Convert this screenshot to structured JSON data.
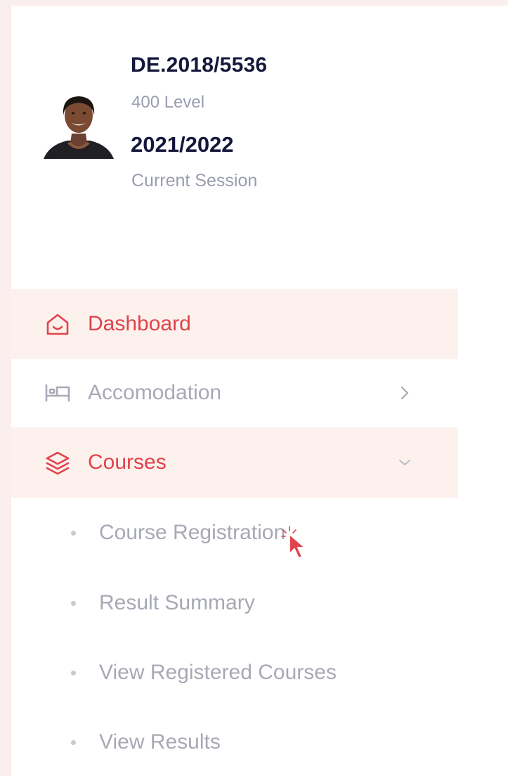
{
  "profile": {
    "reg_number": "DE.2018/5536",
    "level": "400 Level",
    "session": "2021/2022",
    "session_label": "Current Session"
  },
  "nav": {
    "dashboard": "Dashboard",
    "accomodation": "Accomodation",
    "courses": "Courses"
  },
  "courses_submenu": {
    "item_0": "Course Registration",
    "item_1": "Result Summary",
    "item_2": "View Registered Courses",
    "item_3": "View Results"
  },
  "colors": {
    "accent": "#e0434a",
    "active_bg": "#fdf1ee",
    "muted_text": "#a7a9b5",
    "dark_text": "#15173b"
  },
  "icons": {
    "dashboard": "home-icon",
    "accomodation": "bed-icon",
    "courses": "layers-icon",
    "accomodation_chevron": "chevron-right-icon",
    "courses_chevron": "chevron-down-icon"
  }
}
